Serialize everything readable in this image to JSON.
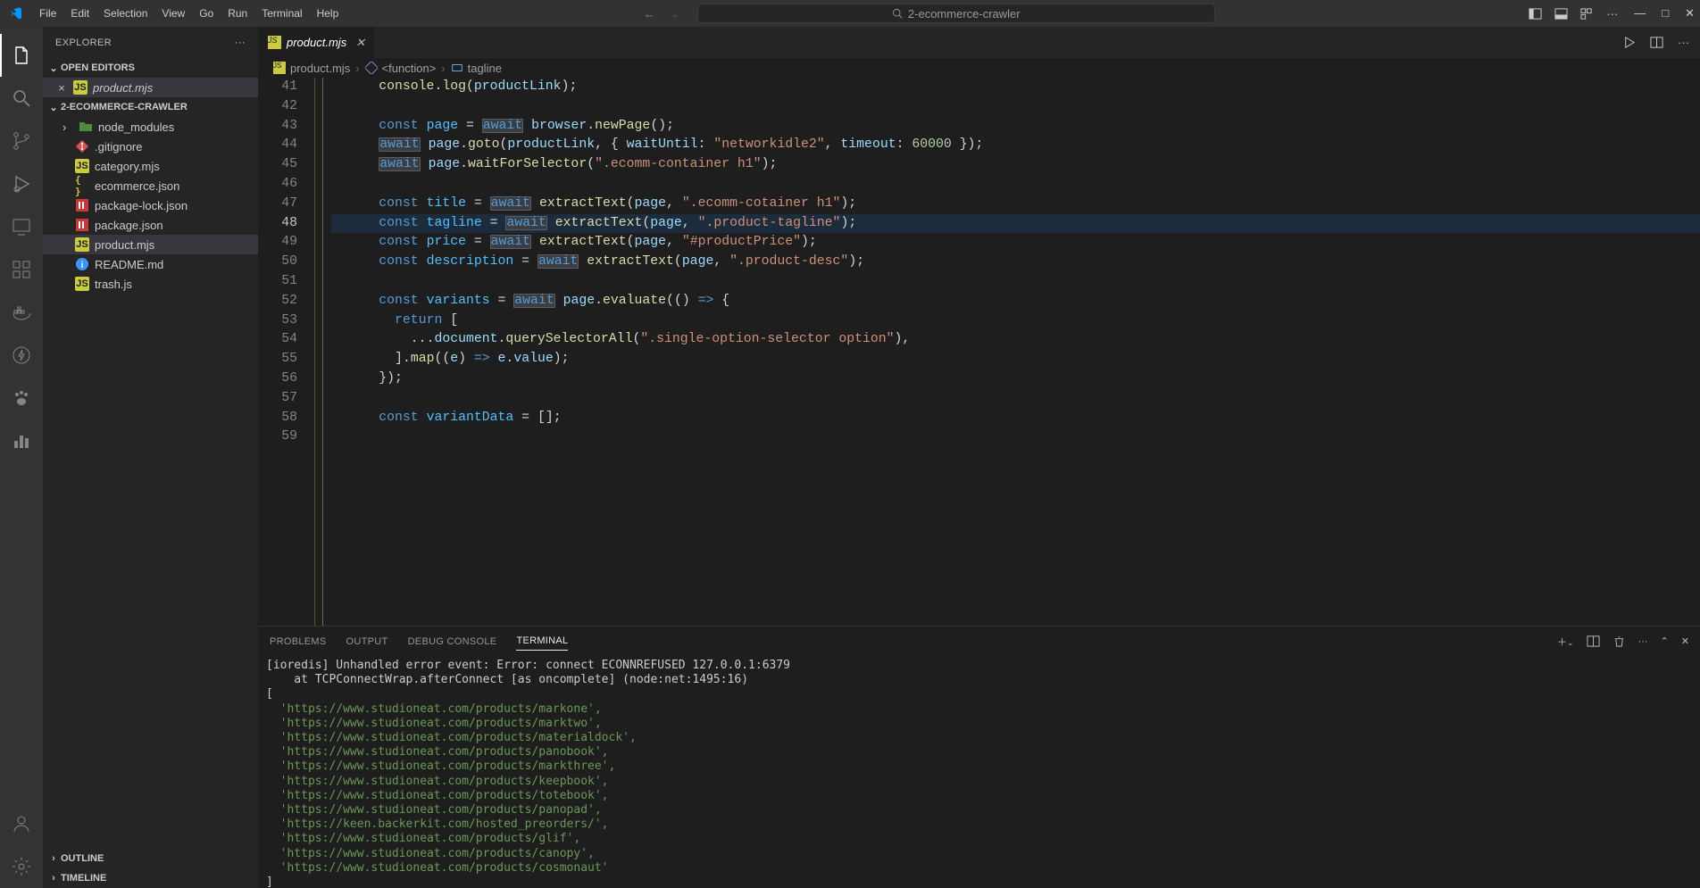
{
  "menu": [
    "File",
    "Edit",
    "Selection",
    "View",
    "Go",
    "Run",
    "Terminal",
    "Help"
  ],
  "search": {
    "placeholder": "2-ecommerce-crawler"
  },
  "sidebar": {
    "title": "EXPLORER",
    "openEditors": "OPEN EDITORS",
    "openEditorsItems": [
      {
        "name": "product.mjs",
        "icon": "js"
      }
    ],
    "workspace": "2-ECOMMERCE-CRAWLER",
    "tree": [
      {
        "name": "node_modules",
        "icon": "folder",
        "chev": true,
        "indent": true
      },
      {
        "name": ".gitignore",
        "icon": "gitignore",
        "indent": true
      },
      {
        "name": "category.mjs",
        "icon": "js",
        "indent": true
      },
      {
        "name": "ecommerce.json",
        "icon": "json",
        "indent": true
      },
      {
        "name": "package-lock.json",
        "icon": "json-lock",
        "indent": true
      },
      {
        "name": "package.json",
        "icon": "json-lock",
        "indent": true
      },
      {
        "name": "product.mjs",
        "icon": "js",
        "indent": true,
        "selected": true
      },
      {
        "name": "README.md",
        "icon": "info",
        "indent": true
      },
      {
        "name": "trash.js",
        "icon": "js",
        "indent": true
      }
    ],
    "outline": "OUTLINE",
    "timeline": "TIMELINE"
  },
  "tab": {
    "name": "product.mjs"
  },
  "breadcrumb": {
    "file": "product.mjs",
    "scope": "<function>",
    "symbol": "tagline"
  },
  "code": {
    "start": 41,
    "activeLine": 48,
    "lines": [
      [
        [
          "      "
        ],
        [
          "fn",
          "console"
        ],
        [
          "pn",
          "."
        ],
        [
          "fn",
          "log"
        ],
        [
          "pn",
          "("
        ],
        [
          "var",
          "productLink"
        ],
        [
          "pn",
          ");"
        ]
      ],
      [],
      [
        [
          "      "
        ],
        [
          "kw",
          "const"
        ],
        [
          " "
        ],
        [
          "const",
          "page"
        ],
        [
          " "
        ],
        [
          "op",
          "="
        ],
        [
          " "
        ],
        [
          "kw",
          "await",
          true
        ],
        [
          " "
        ],
        [
          "var",
          "browser"
        ],
        [
          "pn",
          "."
        ],
        [
          "fn",
          "newPage"
        ],
        [
          "pn",
          "();"
        ]
      ],
      [
        [
          "      "
        ],
        [
          "kw",
          "await",
          true
        ],
        [
          " "
        ],
        [
          "var",
          "page"
        ],
        [
          "pn",
          "."
        ],
        [
          "fn",
          "goto"
        ],
        [
          "pn",
          "("
        ],
        [
          "var",
          "productLink"
        ],
        [
          "pn",
          ", { "
        ],
        [
          "var",
          "waitUntil"
        ],
        [
          "pn",
          ": "
        ],
        [
          "str",
          "\"networkidle2\""
        ],
        [
          "pn",
          ", "
        ],
        [
          "var",
          "timeout"
        ],
        [
          "pn",
          ": "
        ],
        [
          "num",
          "60000"
        ],
        [
          "pn",
          " });"
        ]
      ],
      [
        [
          "      "
        ],
        [
          "kw",
          "await",
          true
        ],
        [
          " "
        ],
        [
          "var",
          "page"
        ],
        [
          "pn",
          "."
        ],
        [
          "fn",
          "waitForSelector"
        ],
        [
          "pn",
          "("
        ],
        [
          "str",
          "\".ecomm-container h1\""
        ],
        [
          "pn",
          ");"
        ]
      ],
      [],
      [
        [
          "      "
        ],
        [
          "kw",
          "const"
        ],
        [
          " "
        ],
        [
          "const",
          "title"
        ],
        [
          " "
        ],
        [
          "op",
          "="
        ],
        [
          " "
        ],
        [
          "kw",
          "await",
          true
        ],
        [
          " "
        ],
        [
          "fn",
          "extractText"
        ],
        [
          "pn",
          "("
        ],
        [
          "var",
          "page"
        ],
        [
          "pn",
          ", "
        ],
        [
          "str",
          "\".ecomm-cotainer h1\""
        ],
        [
          "pn",
          ");"
        ]
      ],
      [
        [
          "      "
        ],
        [
          "kw",
          "const"
        ],
        [
          " "
        ],
        [
          "const",
          "tagline"
        ],
        [
          " "
        ],
        [
          "op",
          "="
        ],
        [
          " "
        ],
        [
          "kw",
          "await",
          true
        ],
        [
          " "
        ],
        [
          "fn",
          "extractText"
        ],
        [
          "pn",
          "("
        ],
        [
          "var",
          "page"
        ],
        [
          "pn",
          ", "
        ],
        [
          "str",
          "\".product-tagline\""
        ],
        [
          "pn",
          ");"
        ]
      ],
      [
        [
          "      "
        ],
        [
          "kw",
          "const"
        ],
        [
          " "
        ],
        [
          "const",
          "price"
        ],
        [
          " "
        ],
        [
          "op",
          "="
        ],
        [
          " "
        ],
        [
          "kw",
          "await",
          true
        ],
        [
          " "
        ],
        [
          "fn",
          "extractText"
        ],
        [
          "pn",
          "("
        ],
        [
          "var",
          "page"
        ],
        [
          "pn",
          ", "
        ],
        [
          "str",
          "\"#productPrice\""
        ],
        [
          "pn",
          ");"
        ]
      ],
      [
        [
          "      "
        ],
        [
          "kw",
          "const"
        ],
        [
          " "
        ],
        [
          "const",
          "description"
        ],
        [
          " "
        ],
        [
          "op",
          "="
        ],
        [
          " "
        ],
        [
          "kw",
          "await",
          true
        ],
        [
          " "
        ],
        [
          "fn",
          "extractText"
        ],
        [
          "pn",
          "("
        ],
        [
          "var",
          "page"
        ],
        [
          "pn",
          ", "
        ],
        [
          "str",
          "\".product-desc\""
        ],
        [
          "pn",
          ");"
        ]
      ],
      [],
      [
        [
          "      "
        ],
        [
          "kw",
          "const"
        ],
        [
          " "
        ],
        [
          "const",
          "variants"
        ],
        [
          " "
        ],
        [
          "op",
          "="
        ],
        [
          " "
        ],
        [
          "kw",
          "await",
          true
        ],
        [
          " "
        ],
        [
          "var",
          "page"
        ],
        [
          "pn",
          "."
        ],
        [
          "fn",
          "evaluate"
        ],
        [
          "pn",
          "(() "
        ],
        [
          "kw",
          "=>"
        ],
        [
          "pn",
          " {"
        ]
      ],
      [
        [
          "        "
        ],
        [
          "kw",
          "return"
        ],
        [
          "pn",
          " ["
        ]
      ],
      [
        [
          "          "
        ],
        [
          "pn",
          "..."
        ],
        [
          "var",
          "document"
        ],
        [
          "pn",
          "."
        ],
        [
          "fn",
          "querySelectorAll"
        ],
        [
          "pn",
          "("
        ],
        [
          "str",
          "\".single-option-selector option\""
        ],
        [
          "pn",
          "),"
        ]
      ],
      [
        [
          "        "
        ],
        [
          "pn",
          "]."
        ],
        [
          "fn",
          "map"
        ],
        [
          "pn",
          "(("
        ],
        [
          "var",
          "e"
        ],
        [
          "pn",
          ") "
        ],
        [
          "kw",
          "=>"
        ],
        [
          " "
        ],
        [
          "var",
          "e"
        ],
        [
          "pn",
          "."
        ],
        [
          "var",
          "value"
        ],
        [
          "pn",
          ");"
        ]
      ],
      [
        [
          "      "
        ],
        [
          "pn",
          "});"
        ]
      ],
      [],
      [
        [
          "      "
        ],
        [
          "kw",
          "const"
        ],
        [
          " "
        ],
        [
          "const",
          "variantData"
        ],
        [
          " "
        ],
        [
          "op",
          "="
        ],
        [
          " "
        ],
        [
          "pn",
          "[];"
        ]
      ],
      []
    ]
  },
  "panel": {
    "tabs": [
      "PROBLEMS",
      "OUTPUT",
      "DEBUG CONSOLE",
      "TERMINAL"
    ],
    "active": 3,
    "terminal": {
      "err1": "[ioredis] Unhandled error event: Error: connect ECONNREFUSED 127.0.0.1:6379",
      "err2": "    at TCPConnectWrap.afterConnect [as oncomplete] (node:net:1495:16)",
      "open": "[",
      "urls": [
        "'https://www.studioneat.com/products/markone',",
        "'https://www.studioneat.com/products/marktwo',",
        "'https://www.studioneat.com/products/materialdock',",
        "'https://www.studioneat.com/products/panobook',",
        "'https://www.studioneat.com/products/markthree',",
        "'https://www.studioneat.com/products/keepbook',",
        "'https://www.studioneat.com/products/totebook',",
        "'https://www.studioneat.com/products/panopad',",
        "'https://keen.backerkit.com/hosted_preorders/',",
        "'https://www.studioneat.com/products/glif',",
        "'https://www.studioneat.com/products/canopy',",
        "'https://www.studioneat.com/products/cosmonaut'"
      ],
      "close": "]"
    }
  }
}
